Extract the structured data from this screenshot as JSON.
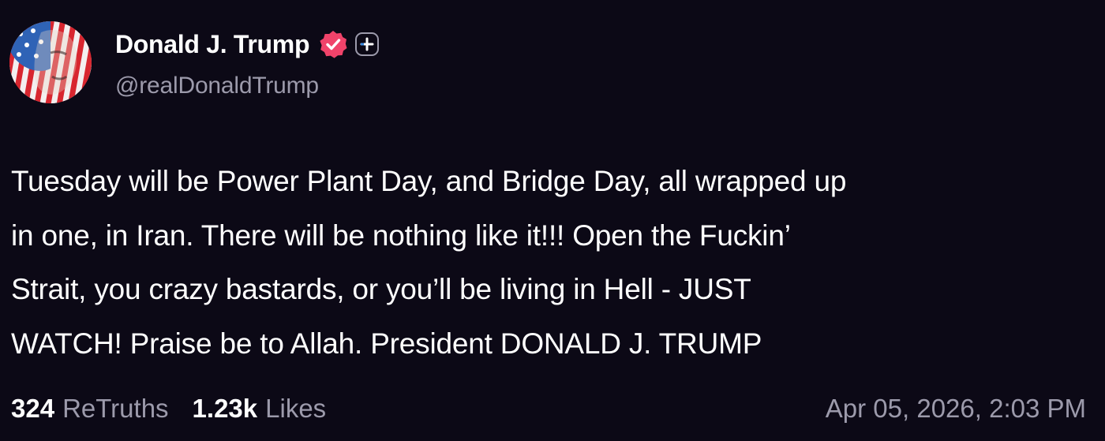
{
  "author": {
    "display_name": "Donald J. Trump",
    "handle": "@realDonaldTrump",
    "avatar_icon": "flag-portrait-avatar",
    "verified_icon": "verified-badge-icon",
    "extra_icon": "plus-badge-icon"
  },
  "post": {
    "lines": [
      "Tuesday will be Power Plant Day, and Bridge Day, all wrapped up",
      "in one, in Iran. There will be nothing like it!!! Open the Fuckin’",
      "Strait, you crazy bastards, or you’ll be living in Hell - JUST",
      "WATCH! Praise be to Allah. President DONALD J. TRUMP"
    ]
  },
  "stats": {
    "retruths_count": "324",
    "retruths_label": "ReTruths",
    "likes_count": "1.23k",
    "likes_label": "Likes"
  },
  "timestamp": "Apr 05, 2026, 2:03 PM",
  "colors": {
    "background": "#0c0916",
    "text": "#ffffff",
    "muted": "#9c9aab",
    "verified_badge": "#f0436a",
    "flag_red": "#d8262f",
    "flag_blue": "#2f63b6"
  }
}
